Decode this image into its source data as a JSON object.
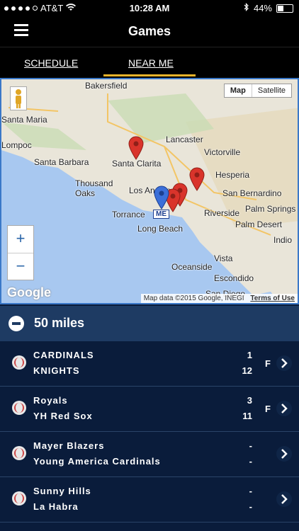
{
  "status_bar": {
    "carrier": "AT&T",
    "time": "10:28 AM",
    "battery": "44%",
    "battery_level": 0.44
  },
  "nav": {
    "title": "Games"
  },
  "tabs": [
    {
      "label": "SCHEDULE"
    },
    {
      "label": "NEAR ME"
    }
  ],
  "map": {
    "type_buttons": [
      "Map",
      "Satellite"
    ],
    "zoom_in": "+",
    "zoom_out": "−",
    "watermark": "Google",
    "credit": "Map data ©2015 Google, INEGI",
    "terms": "Terms of Use",
    "me_label": "ME",
    "places": [
      "Bakersfield",
      "Lancaster",
      "Santa Maria",
      "Lompoc",
      "Santa Barbara",
      "Santa Clarita",
      "Victorville",
      "Hesperia",
      "Thousand Oaks",
      "Los Angeles",
      "San Bernardino",
      "Palm Springs",
      "Torrance",
      "Riverside",
      "Long Beach",
      "Palm Desert",
      "Oceanside",
      "Vista",
      "Escondido",
      "San Diego",
      "Indio"
    ]
  },
  "radius": {
    "label": "50 miles"
  },
  "games": [
    {
      "home": "CARDINALS",
      "away": "KNIGHTS",
      "home_score": "1",
      "away_score": "12",
      "status": "F"
    },
    {
      "home": "Royals",
      "away": "YH Red Sox",
      "home_score": "3",
      "away_score": "11",
      "status": "F"
    },
    {
      "home": "Mayer Blazers",
      "away": "Young America Cardinals",
      "home_score": "-",
      "away_score": "-",
      "status": ""
    },
    {
      "home": "Sunny Hills",
      "away": "La Habra",
      "home_score": "-",
      "away_score": "-",
      "status": ""
    }
  ],
  "colors": {
    "accent": "#e8b32a",
    "navy": "#0a1c3b",
    "pin_red": "#d9342b",
    "pin_blue": "#3b6fd9"
  }
}
